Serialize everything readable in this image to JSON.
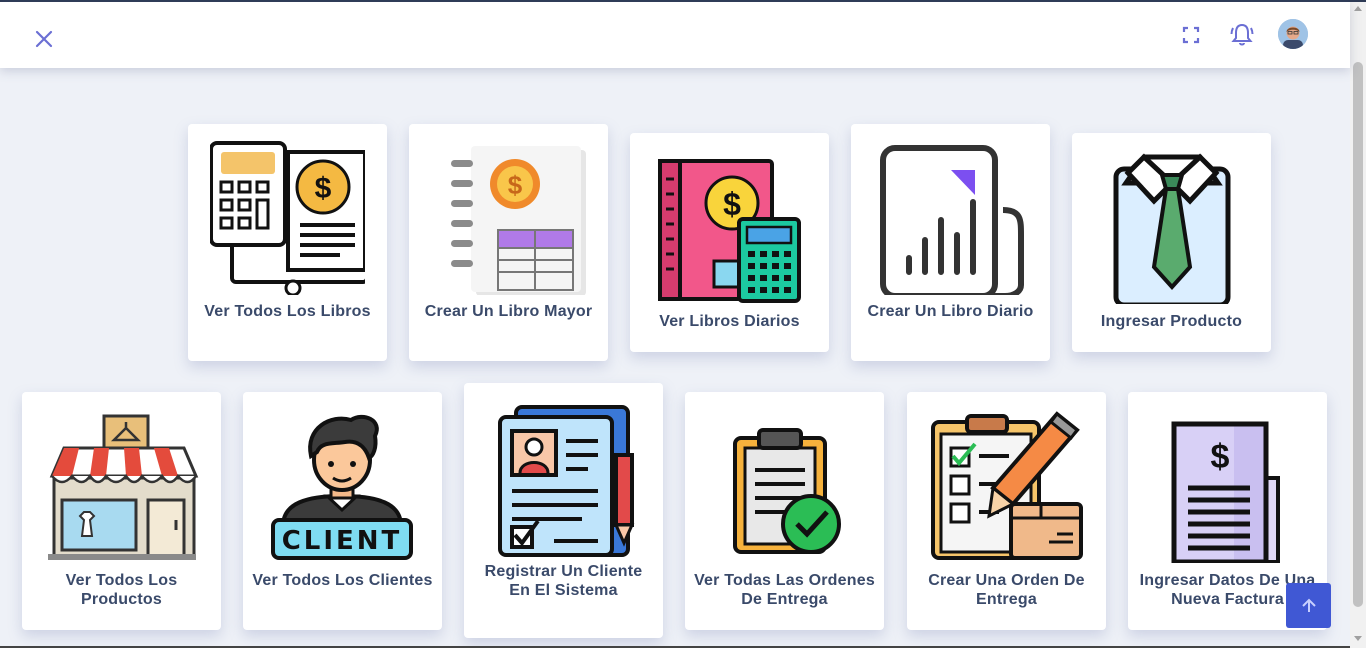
{
  "navbar": {
    "close_icon": "close-icon",
    "fullscreen_icon": "fullscreen-icon",
    "notification_icon": "bell-icon",
    "avatar_icon": "user-avatar"
  },
  "colors": {
    "accent": "#4058d4",
    "label": "#3a4a6a",
    "nav_icon": "#6b6fd4"
  },
  "cards": [
    {
      "label": "Ver Todos Los Libros",
      "icon": "ledger-calculator-icon"
    },
    {
      "label": "Crear Un Libro Mayor",
      "icon": "notebook-table-icon"
    },
    {
      "label": "Ver Libros Diarios",
      "icon": "book-calculator-icon"
    },
    {
      "label": "Crear Un Libro Diario",
      "icon": "report-chart-icon"
    },
    {
      "label": "Ingresar Producto",
      "icon": "shirt-tie-icon"
    },
    {
      "label": "Ver Todos Los Productos",
      "icon": "store-icon"
    },
    {
      "label": "Ver Todos Los Clientes",
      "icon": "client-icon"
    },
    {
      "label": "Registrar Un Cliente En El Sistema",
      "icon": "registration-form-icon"
    },
    {
      "label": "Ver Todas Las Ordenes De Entrega",
      "icon": "clipboard-check-icon"
    },
    {
      "label": "Crear Una Orden De Entrega",
      "icon": "checklist-pencil-icon"
    },
    {
      "label": "Ingresar Datos De Una Nueva Factura",
      "icon": "invoice-icon"
    }
  ],
  "client_sign_text": "CLIENT",
  "scroll_top_icon": "arrow-up-icon"
}
